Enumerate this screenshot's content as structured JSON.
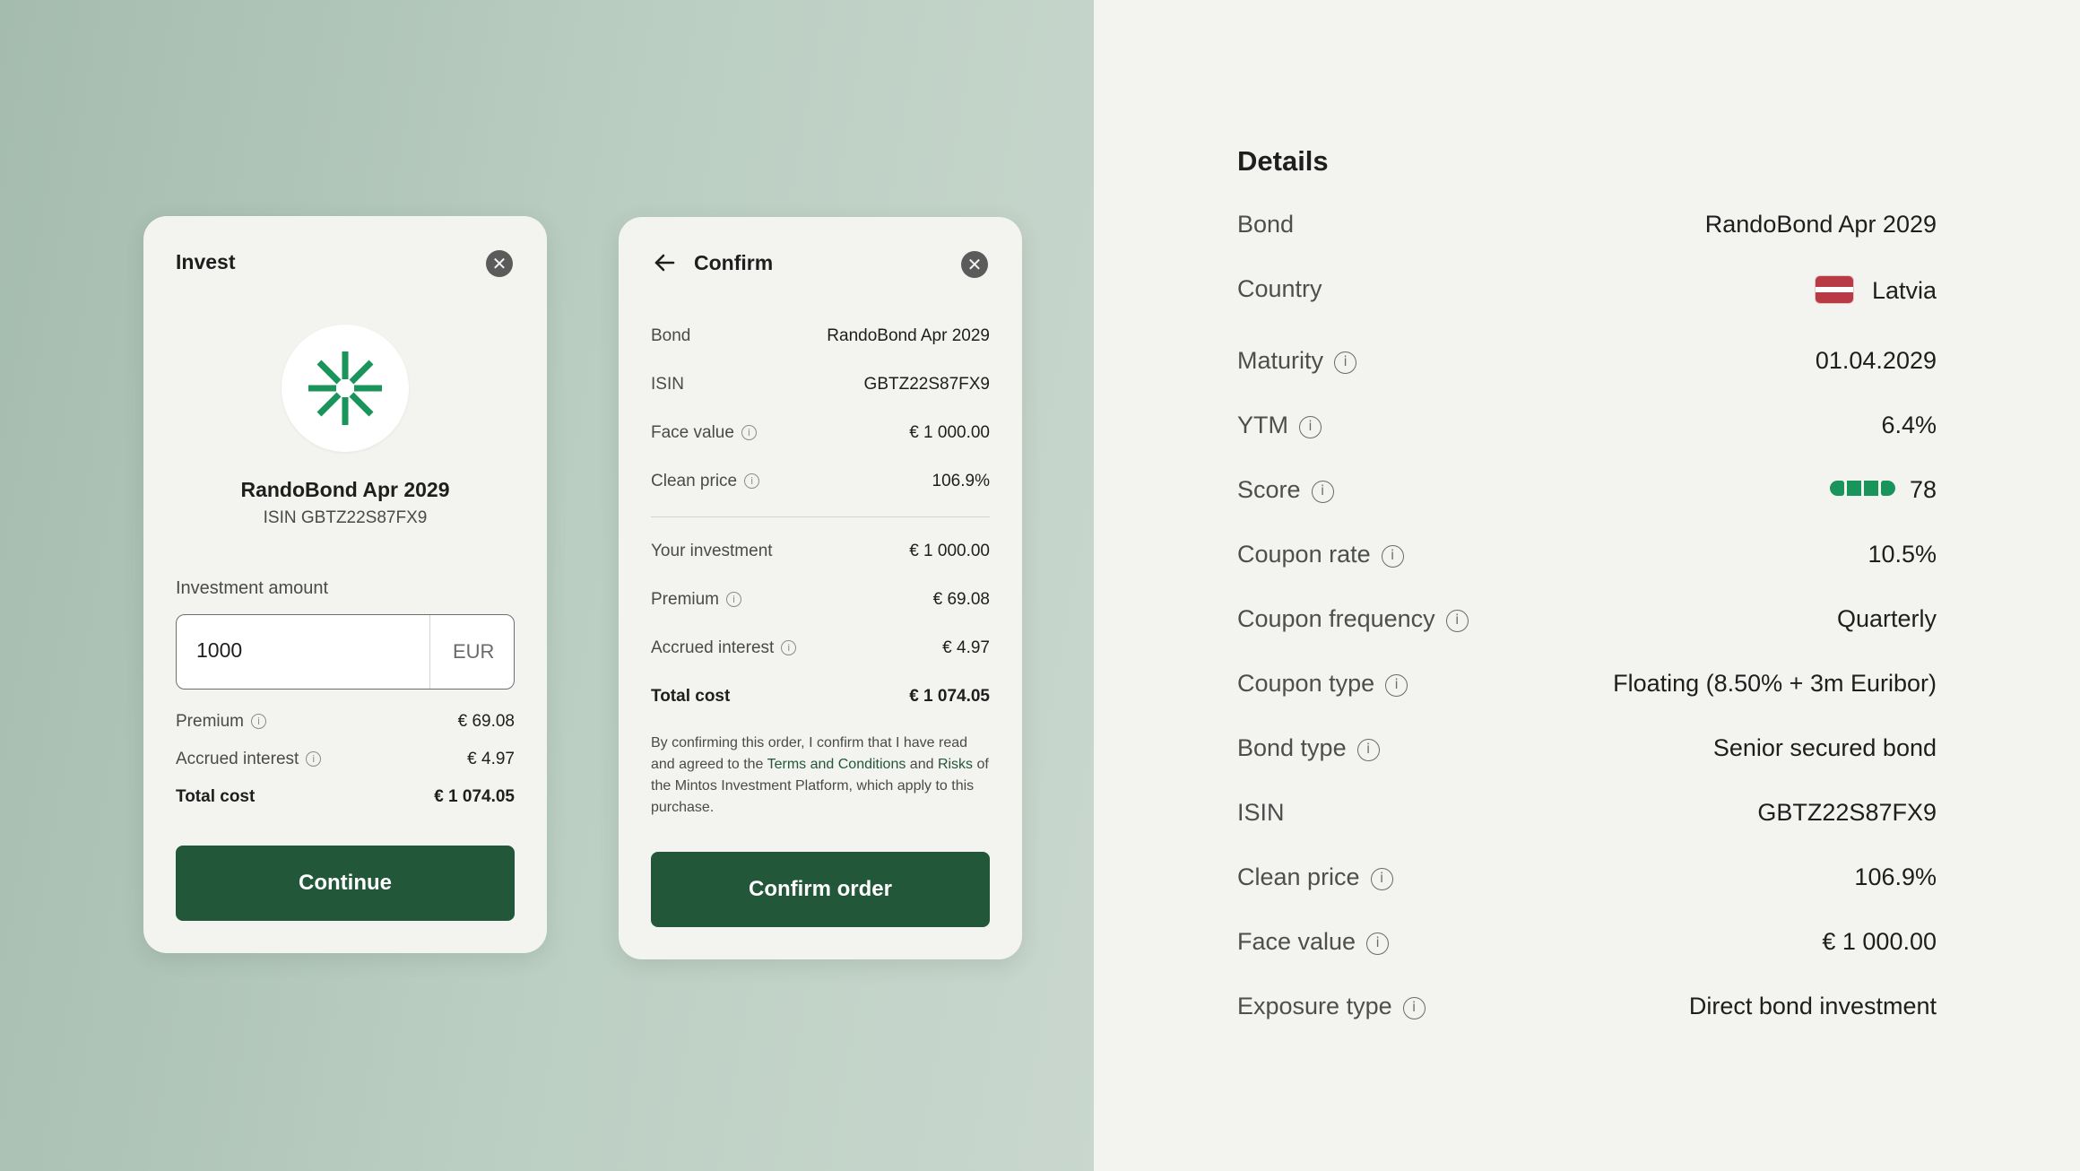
{
  "invest_card": {
    "title": "Invest",
    "bond_name": "RandoBond Apr 2029",
    "bond_isin": "ISIN GBTZ22S87FX9",
    "amount_label": "Investment amount",
    "amount_value": "1000",
    "currency": "EUR",
    "rows": [
      {
        "label": "Premium",
        "value": "€ 69.08"
      },
      {
        "label": "Accrued interest",
        "value": "€ 4.97"
      },
      {
        "label": "Total cost",
        "value": "€ 1 074.05"
      }
    ],
    "continue_label": "Continue",
    "icons": {
      "close": "close-icon",
      "logo": "asterisk-logo-icon"
    },
    "colors": {
      "primary": "#235739",
      "logo_green": "#19945a"
    }
  },
  "confirm_card": {
    "title": "Confirm",
    "rows_top": [
      {
        "label": "Bond",
        "value": "RandoBond Apr 2029"
      },
      {
        "label": "ISIN",
        "value": "GBTZ22S87FX9"
      },
      {
        "label": "Face value",
        "value": "€ 1 000.00"
      },
      {
        "label": "Clean price",
        "value": "106.9%"
      }
    ],
    "rows_bottom": [
      {
        "label": "Your investment",
        "value": "€ 1 000.00"
      },
      {
        "label": "Premium",
        "value": "€ 69.08"
      },
      {
        "label": "Accrued interest",
        "value": "€ 4.97"
      },
      {
        "label": "Total cost",
        "value": "€ 1 074.05"
      }
    ],
    "legal": {
      "part1": "By confirming this order, I confirm that I have read and agreed to the ",
      "terms_link": "Terms and Conditions",
      "part2": " and ",
      "risks_link": "Risks",
      "part3": " of the Mintos Investment Platform, which apply to this purchase."
    },
    "confirm_label": "Confirm order",
    "icons": {
      "back": "arrow-left-icon",
      "close": "close-icon"
    }
  },
  "details": {
    "title": "Details",
    "rows": [
      {
        "label": "Bond",
        "value": "RandoBond Apr 2029"
      },
      {
        "label": "Country",
        "value": "Latvia"
      },
      {
        "label": "Maturity",
        "value": "01.04.2029"
      },
      {
        "label": "YTM",
        "value": "6.4%"
      },
      {
        "label": "Score",
        "value": "78"
      },
      {
        "label": "Coupon rate",
        "value": "10.5%"
      },
      {
        "label": "Coupon frequency",
        "value": "Quarterly"
      },
      {
        "label": "Coupon type",
        "value": "Floating (8.50% + 3m Euribor)"
      },
      {
        "label": "Bond type",
        "value": "Senior secured bond"
      },
      {
        "label": "ISIN",
        "value": "GBTZ22S87FX9"
      },
      {
        "label": "Clean price",
        "value": "106.9%"
      },
      {
        "label": "Face value",
        "value": "€ 1 000.00"
      },
      {
        "label": "Exposure type",
        "value": "Direct bond investment"
      }
    ],
    "score_bar": {
      "filled_segments": 4,
      "total_segments": 4,
      "color": "#19945a"
    },
    "flag_colors": {
      "red": "#b73a45",
      "white": "#ffffff"
    }
  }
}
